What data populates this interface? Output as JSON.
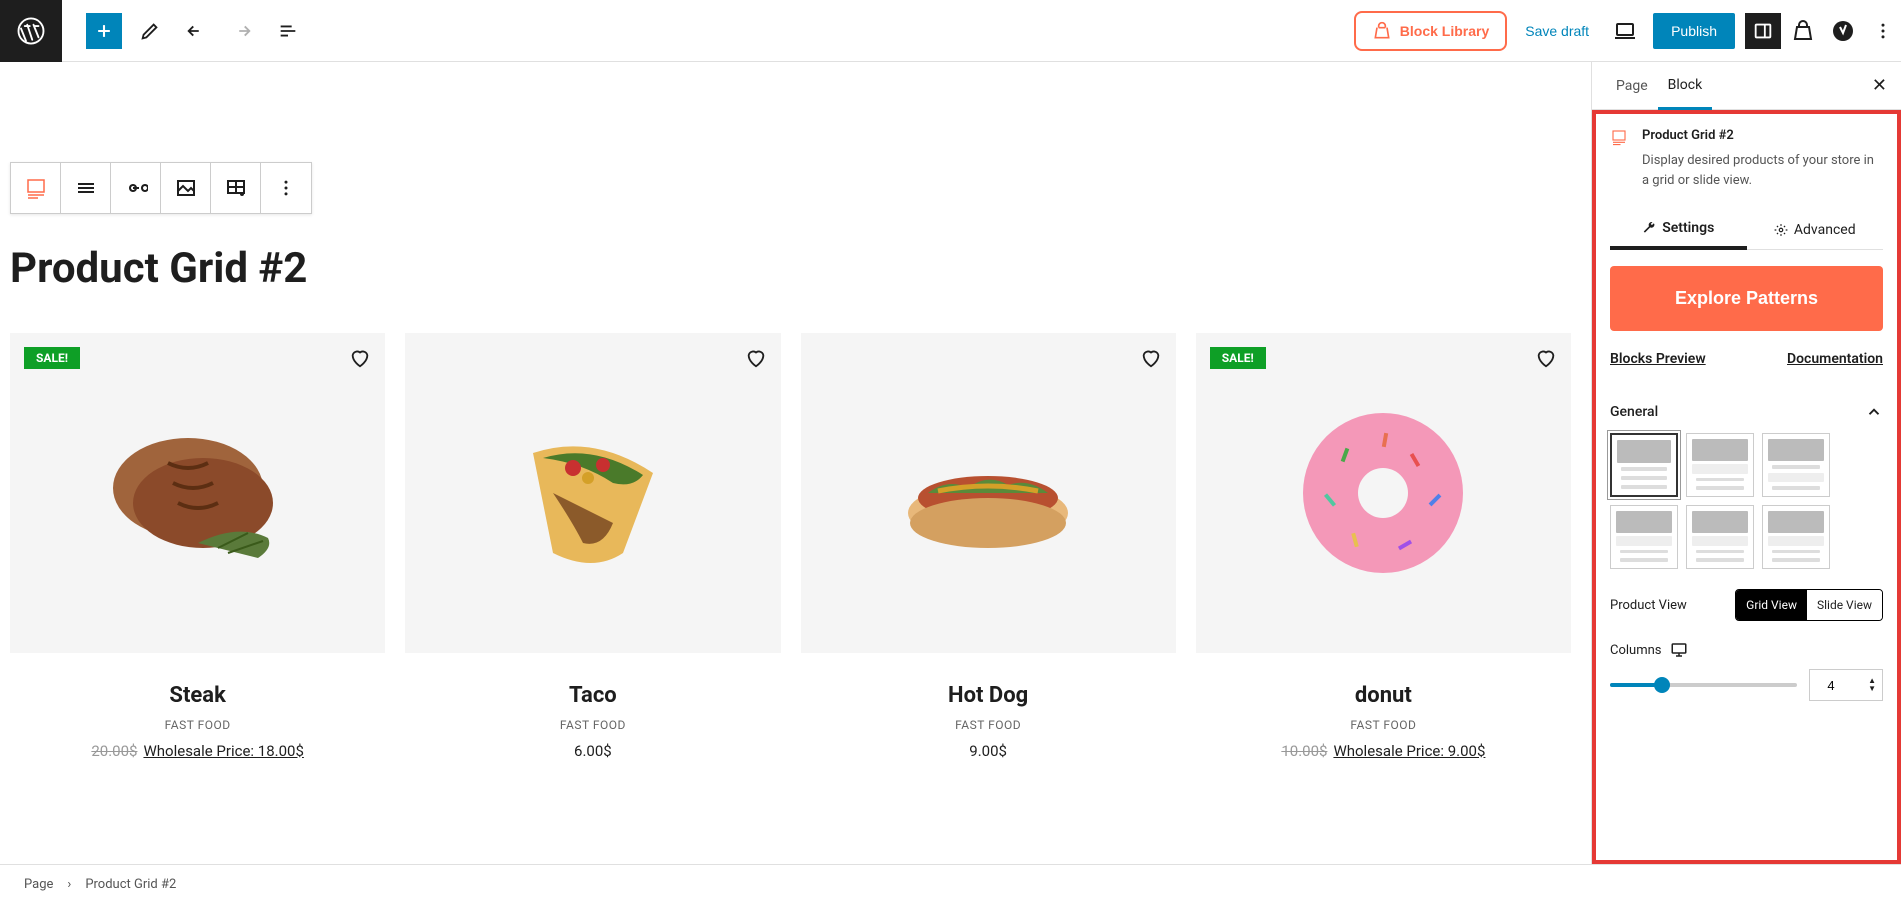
{
  "toolbar": {
    "block_library_label": "Block Library",
    "save_draft_label": "Save draft",
    "publish_label": "Publish"
  },
  "editor": {
    "grid_heading": "Product Grid #2",
    "products": [
      {
        "name": "Steak",
        "category": "FAST FOOD",
        "sale": true,
        "old_price": "20.00$",
        "wholesale_label": "Wholesale Price: 18.00$"
      },
      {
        "name": "Taco",
        "category": "FAST FOOD",
        "sale": false,
        "price": "6.00$"
      },
      {
        "name": "Hot Dog",
        "category": "FAST FOOD",
        "sale": false,
        "price": "9.00$"
      },
      {
        "name": "donut",
        "category": "FAST FOOD",
        "sale": true,
        "old_price": "10.00$",
        "wholesale_label": "Wholesale Price: 9.00$"
      }
    ],
    "sale_label": "SALE!"
  },
  "sidebar": {
    "tabs": {
      "page": "Page",
      "block": "Block"
    },
    "block_title": "Product Grid #2",
    "block_desc": "Display desired products of your store in a grid or slide view.",
    "sub_tabs": {
      "settings": "Settings",
      "advanced": "Advanced"
    },
    "explore_label": "Explore Patterns",
    "blocks_preview": "Blocks Preview",
    "documentation": "Documentation",
    "panel_general": "General",
    "product_view_label": "Product View",
    "view_grid": "Grid View",
    "view_slide": "Slide View",
    "columns_label": "Columns",
    "columns_value": "4"
  },
  "breadcrumb": {
    "item1": "Page",
    "item2": "Product Grid #2"
  }
}
